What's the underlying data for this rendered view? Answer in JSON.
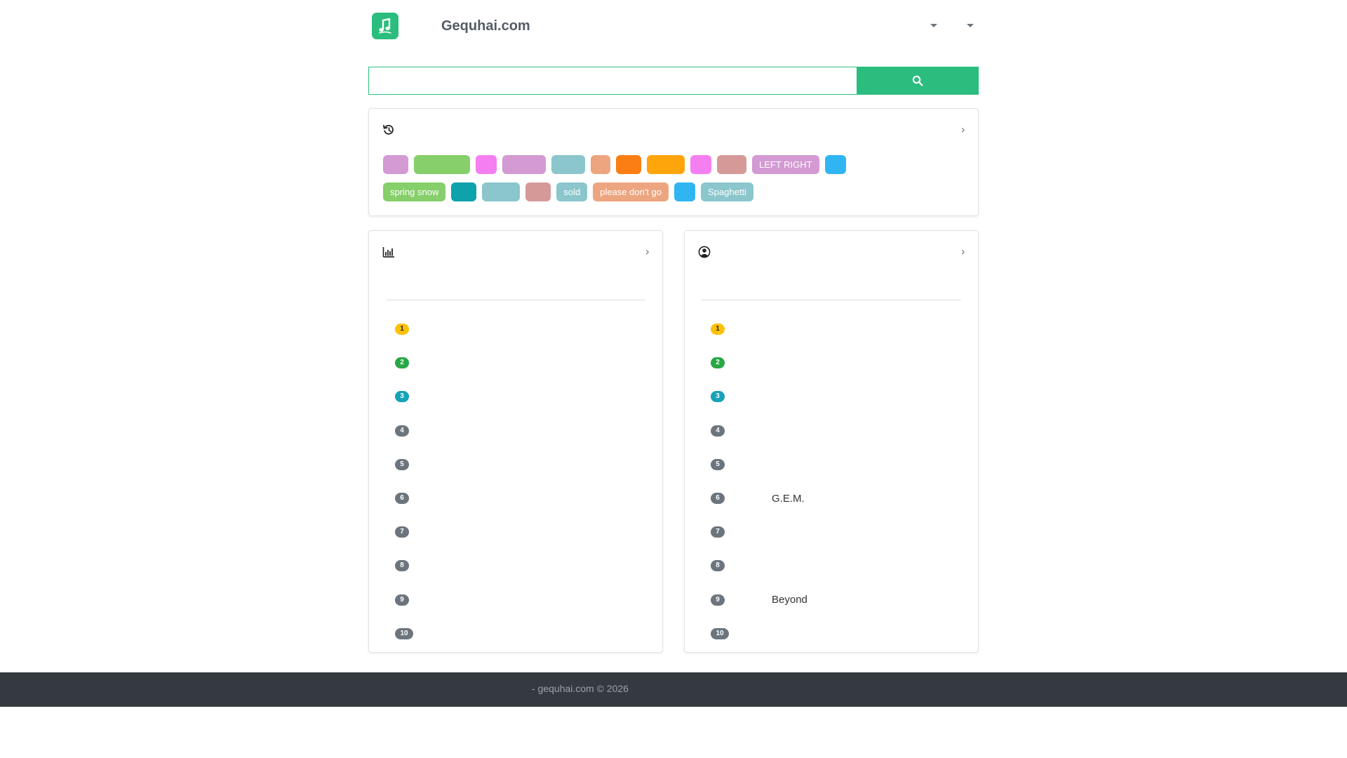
{
  "header": {
    "brand": "Gequhai.com",
    "logo_icon": "music-note-icon",
    "brand_color": "#2bbd7e",
    "dropdowns": [
      {
        "label": "",
        "icon": "caret-down-icon"
      },
      {
        "label": "",
        "icon": "caret-down-icon"
      }
    ]
  },
  "search": {
    "value": "",
    "placeholder": "",
    "button_icon": "search-icon"
  },
  "history": {
    "icon": "history-icon",
    "more_icon": "chevron-right-icon",
    "tags": [
      {
        "label": "",
        "color": "#d39ad3"
      },
      {
        "label": "",
        "color": "#86cf6b"
      },
      {
        "label": "",
        "color": "#f57ff0"
      },
      {
        "label": "",
        "color": "#d39ad3"
      },
      {
        "label": "",
        "color": "#8ac6cc"
      },
      {
        "label": "",
        "color": "#eca57f"
      },
      {
        "label": "",
        "color": "#fb7e14"
      },
      {
        "label": "",
        "color": "#fea50b"
      },
      {
        "label": "",
        "color": "#f57ff0"
      },
      {
        "label": "",
        "color": "#d59a98"
      },
      {
        "label": "LEFT RIGHT",
        "color": "#d39ad3"
      },
      {
        "label": "",
        "color": "#31b5f2"
      },
      {
        "label": "spring snow",
        "color": "#86cf6b"
      },
      {
        "label": "",
        "color": "#0ea2ad"
      },
      {
        "label": "",
        "color": "#8ac6cc"
      },
      {
        "label": "",
        "color": "#d59a98"
      },
      {
        "label": "sold",
        "color": "#8ac6cc"
      },
      {
        "label": "please don't go",
        "color": "#eca57f"
      },
      {
        "label": "",
        "color": "#31b5f2"
      },
      {
        "label": "Spaghetti",
        "color": "#8ac6cc"
      }
    ]
  },
  "songs_chart": {
    "icon": "bar-chart-icon",
    "more_icon": "chevron-right-icon",
    "items": [
      {
        "rank": "1",
        "name": "",
        "badge_color": "#ffc107",
        "badge_text_color": "#212529"
      },
      {
        "rank": "2",
        "name": "",
        "badge_color": "#28a745",
        "badge_text_color": "#ffffff"
      },
      {
        "rank": "3",
        "name": "",
        "badge_color": "#17a2b8",
        "badge_text_color": "#ffffff"
      },
      {
        "rank": "4",
        "name": "",
        "badge_color": "#6c757d",
        "badge_text_color": "#ffffff"
      },
      {
        "rank": "5",
        "name": "",
        "badge_color": "#6c757d",
        "badge_text_color": "#ffffff"
      },
      {
        "rank": "6",
        "name": "",
        "badge_color": "#6c757d",
        "badge_text_color": "#ffffff"
      },
      {
        "rank": "7",
        "name": "",
        "badge_color": "#6c757d",
        "badge_text_color": "#ffffff"
      },
      {
        "rank": "8",
        "name": "",
        "badge_color": "#6c757d",
        "badge_text_color": "#ffffff"
      },
      {
        "rank": "9",
        "name": "",
        "badge_color": "#6c757d",
        "badge_text_color": "#ffffff"
      },
      {
        "rank": "10",
        "name": "",
        "badge_color": "#6c757d",
        "badge_text_color": "#ffffff"
      }
    ]
  },
  "artists_chart": {
    "icon": "user-circle-icon",
    "more_icon": "chevron-right-icon",
    "items": [
      {
        "rank": "1",
        "name": "",
        "badge_color": "#ffc107",
        "badge_text_color": "#212529"
      },
      {
        "rank": "2",
        "name": "",
        "badge_color": "#28a745",
        "badge_text_color": "#ffffff"
      },
      {
        "rank": "3",
        "name": "",
        "badge_color": "#17a2b8",
        "badge_text_color": "#ffffff"
      },
      {
        "rank": "4",
        "name": "",
        "badge_color": "#6c757d",
        "badge_text_color": "#ffffff"
      },
      {
        "rank": "5",
        "name": "",
        "badge_color": "#6c757d",
        "badge_text_color": "#ffffff"
      },
      {
        "rank": "6",
        "name": "G.E.M.",
        "badge_color": "#6c757d",
        "badge_text_color": "#ffffff"
      },
      {
        "rank": "7",
        "name": "",
        "badge_color": "#6c757d",
        "badge_text_color": "#ffffff"
      },
      {
        "rank": "8",
        "name": "",
        "badge_color": "#6c757d",
        "badge_text_color": "#ffffff"
      },
      {
        "rank": "9",
        "name": "Beyond",
        "badge_color": "#6c757d",
        "badge_text_color": "#ffffff"
      },
      {
        "rank": "10",
        "name": "",
        "badge_color": "#6c757d",
        "badge_text_color": "#ffffff"
      }
    ]
  },
  "footer": {
    "text": "- gequhai.com © 2026",
    "background": "#343a40"
  }
}
